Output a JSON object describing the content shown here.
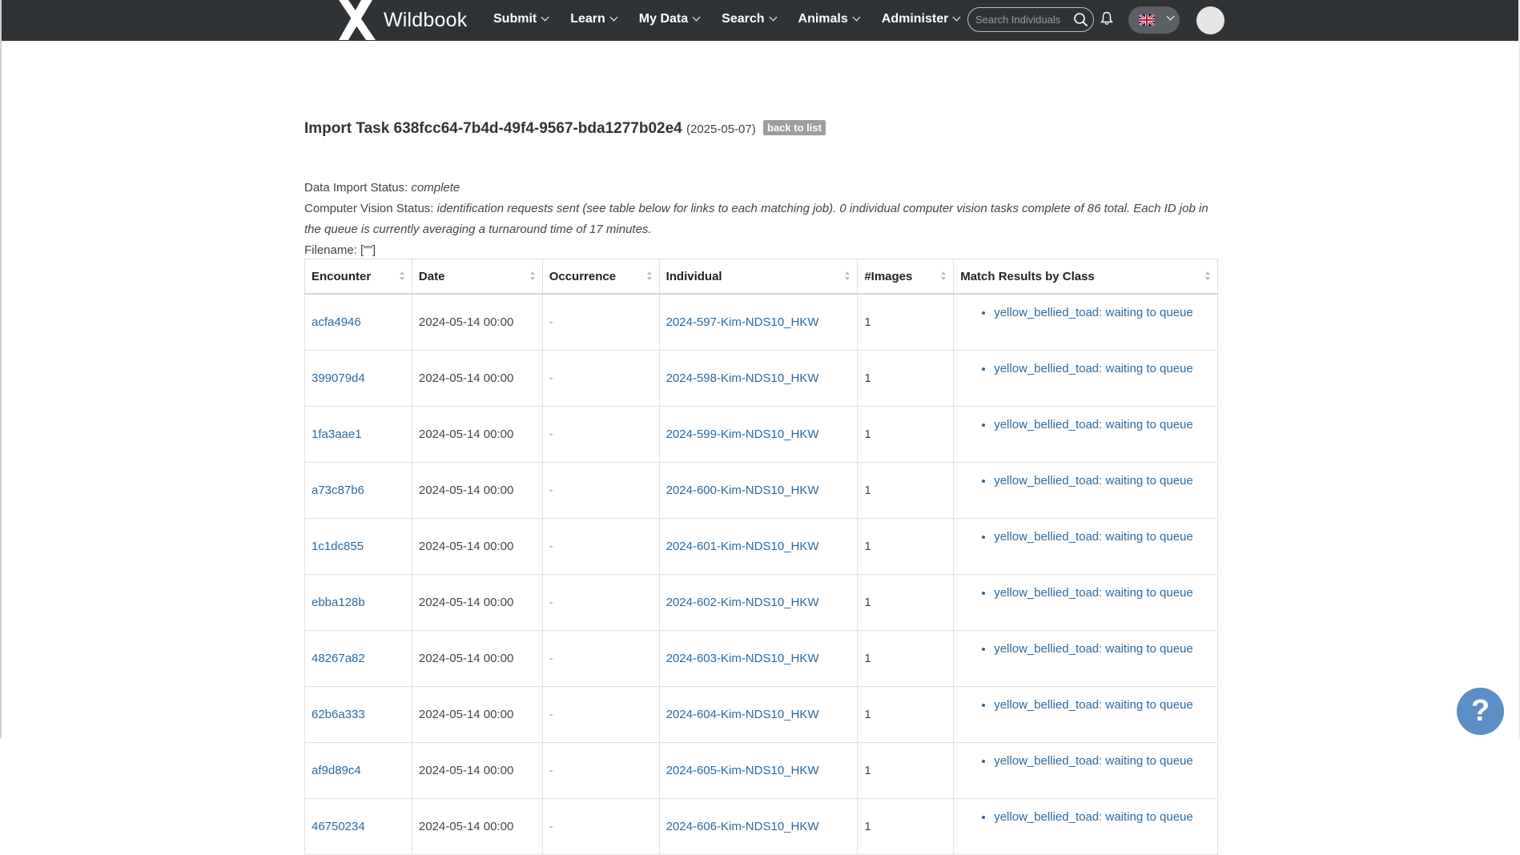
{
  "nav": {
    "brand": "Wildbook",
    "menu": [
      {
        "label": "Submit"
      },
      {
        "label": "Learn"
      },
      {
        "label": "My Data"
      },
      {
        "label": "Search"
      },
      {
        "label": "Animals"
      },
      {
        "label": "Administer"
      }
    ],
    "search_placeholder": "Search Individuals",
    "language": "en-GB"
  },
  "page": {
    "title": "Import Task 638fcc64-7b4d-49f4-9567-bda1277b02e4",
    "date": "(2025-05-07)",
    "back_label": "back to list",
    "data_status_label": "Data Import Status:",
    "data_status_value": "complete",
    "cv_status_label": "Computer Vision Status:",
    "cv_status_value": "identification requests sent (see table below for links to each matching job). 0 individual computer vision tasks complete of 86 total. Each ID job in the queue is currently averaging a turnaround time of 17 minutes.",
    "filename_label": "Filename:",
    "filename_value": "[\"\"]"
  },
  "table": {
    "headers": [
      "Encounter",
      "Date",
      "Occurrence",
      "Individual",
      "#Images",
      "Match Results by Class"
    ],
    "rows": [
      {
        "encounter": "acfa4946",
        "date": "2024-05-14 00:00",
        "occurrence": "-",
        "individual": "2024-597-Kim-NDS10_HKW",
        "images": "1",
        "match": "yellow_bellied_toad: waiting to queue"
      },
      {
        "encounter": "399079d4",
        "date": "2024-05-14 00:00",
        "occurrence": "-",
        "individual": "2024-598-Kim-NDS10_HKW",
        "images": "1",
        "match": "yellow_bellied_toad: waiting to queue"
      },
      {
        "encounter": "1fa3aae1",
        "date": "2024-05-14 00:00",
        "occurrence": "-",
        "individual": "2024-599-Kim-NDS10_HKW",
        "images": "1",
        "match": "yellow_bellied_toad: waiting to queue"
      },
      {
        "encounter": "a73c87b6",
        "date": "2024-05-14 00:00",
        "occurrence": "-",
        "individual": "2024-600-Kim-NDS10_HKW",
        "images": "1",
        "match": "yellow_bellied_toad: waiting to queue"
      },
      {
        "encounter": "1c1dc855",
        "date": "2024-05-14 00:00",
        "occurrence": "-",
        "individual": "2024-601-Kim-NDS10_HKW",
        "images": "1",
        "match": "yellow_bellied_toad: waiting to queue"
      },
      {
        "encounter": "ebba128b",
        "date": "2024-05-14 00:00",
        "occurrence": "-",
        "individual": "2024-602-Kim-NDS10_HKW",
        "images": "1",
        "match": "yellow_bellied_toad: waiting to queue"
      },
      {
        "encounter": "48267a82",
        "date": "2024-05-14 00:00",
        "occurrence": "-",
        "individual": "2024-603-Kim-NDS10_HKW",
        "images": "1",
        "match": "yellow_bellied_toad: waiting to queue"
      },
      {
        "encounter": "62b6a333",
        "date": "2024-05-14 00:00",
        "occurrence": "-",
        "individual": "2024-604-Kim-NDS10_HKW",
        "images": "1",
        "match": "yellow_bellied_toad: waiting to queue"
      },
      {
        "encounter": "af9d89c4",
        "date": "2024-05-14 00:00",
        "occurrence": "-",
        "individual": "2024-605-Kim-NDS10_HKW",
        "images": "1",
        "match": "yellow_bellied_toad: waiting to queue"
      },
      {
        "encounter": "46750234",
        "date": "2024-05-14 00:00",
        "occurrence": "-",
        "individual": "2024-606-Kim-NDS10_HKW",
        "images": "1",
        "match": "yellow_bellied_toad: waiting to queue"
      }
    ]
  },
  "help": {
    "label": "?"
  },
  "colors": {
    "navbar": "#303336",
    "link": "#2b6a9e",
    "help_button": "#5b8fc5",
    "back_button": "#9e9e9e"
  }
}
